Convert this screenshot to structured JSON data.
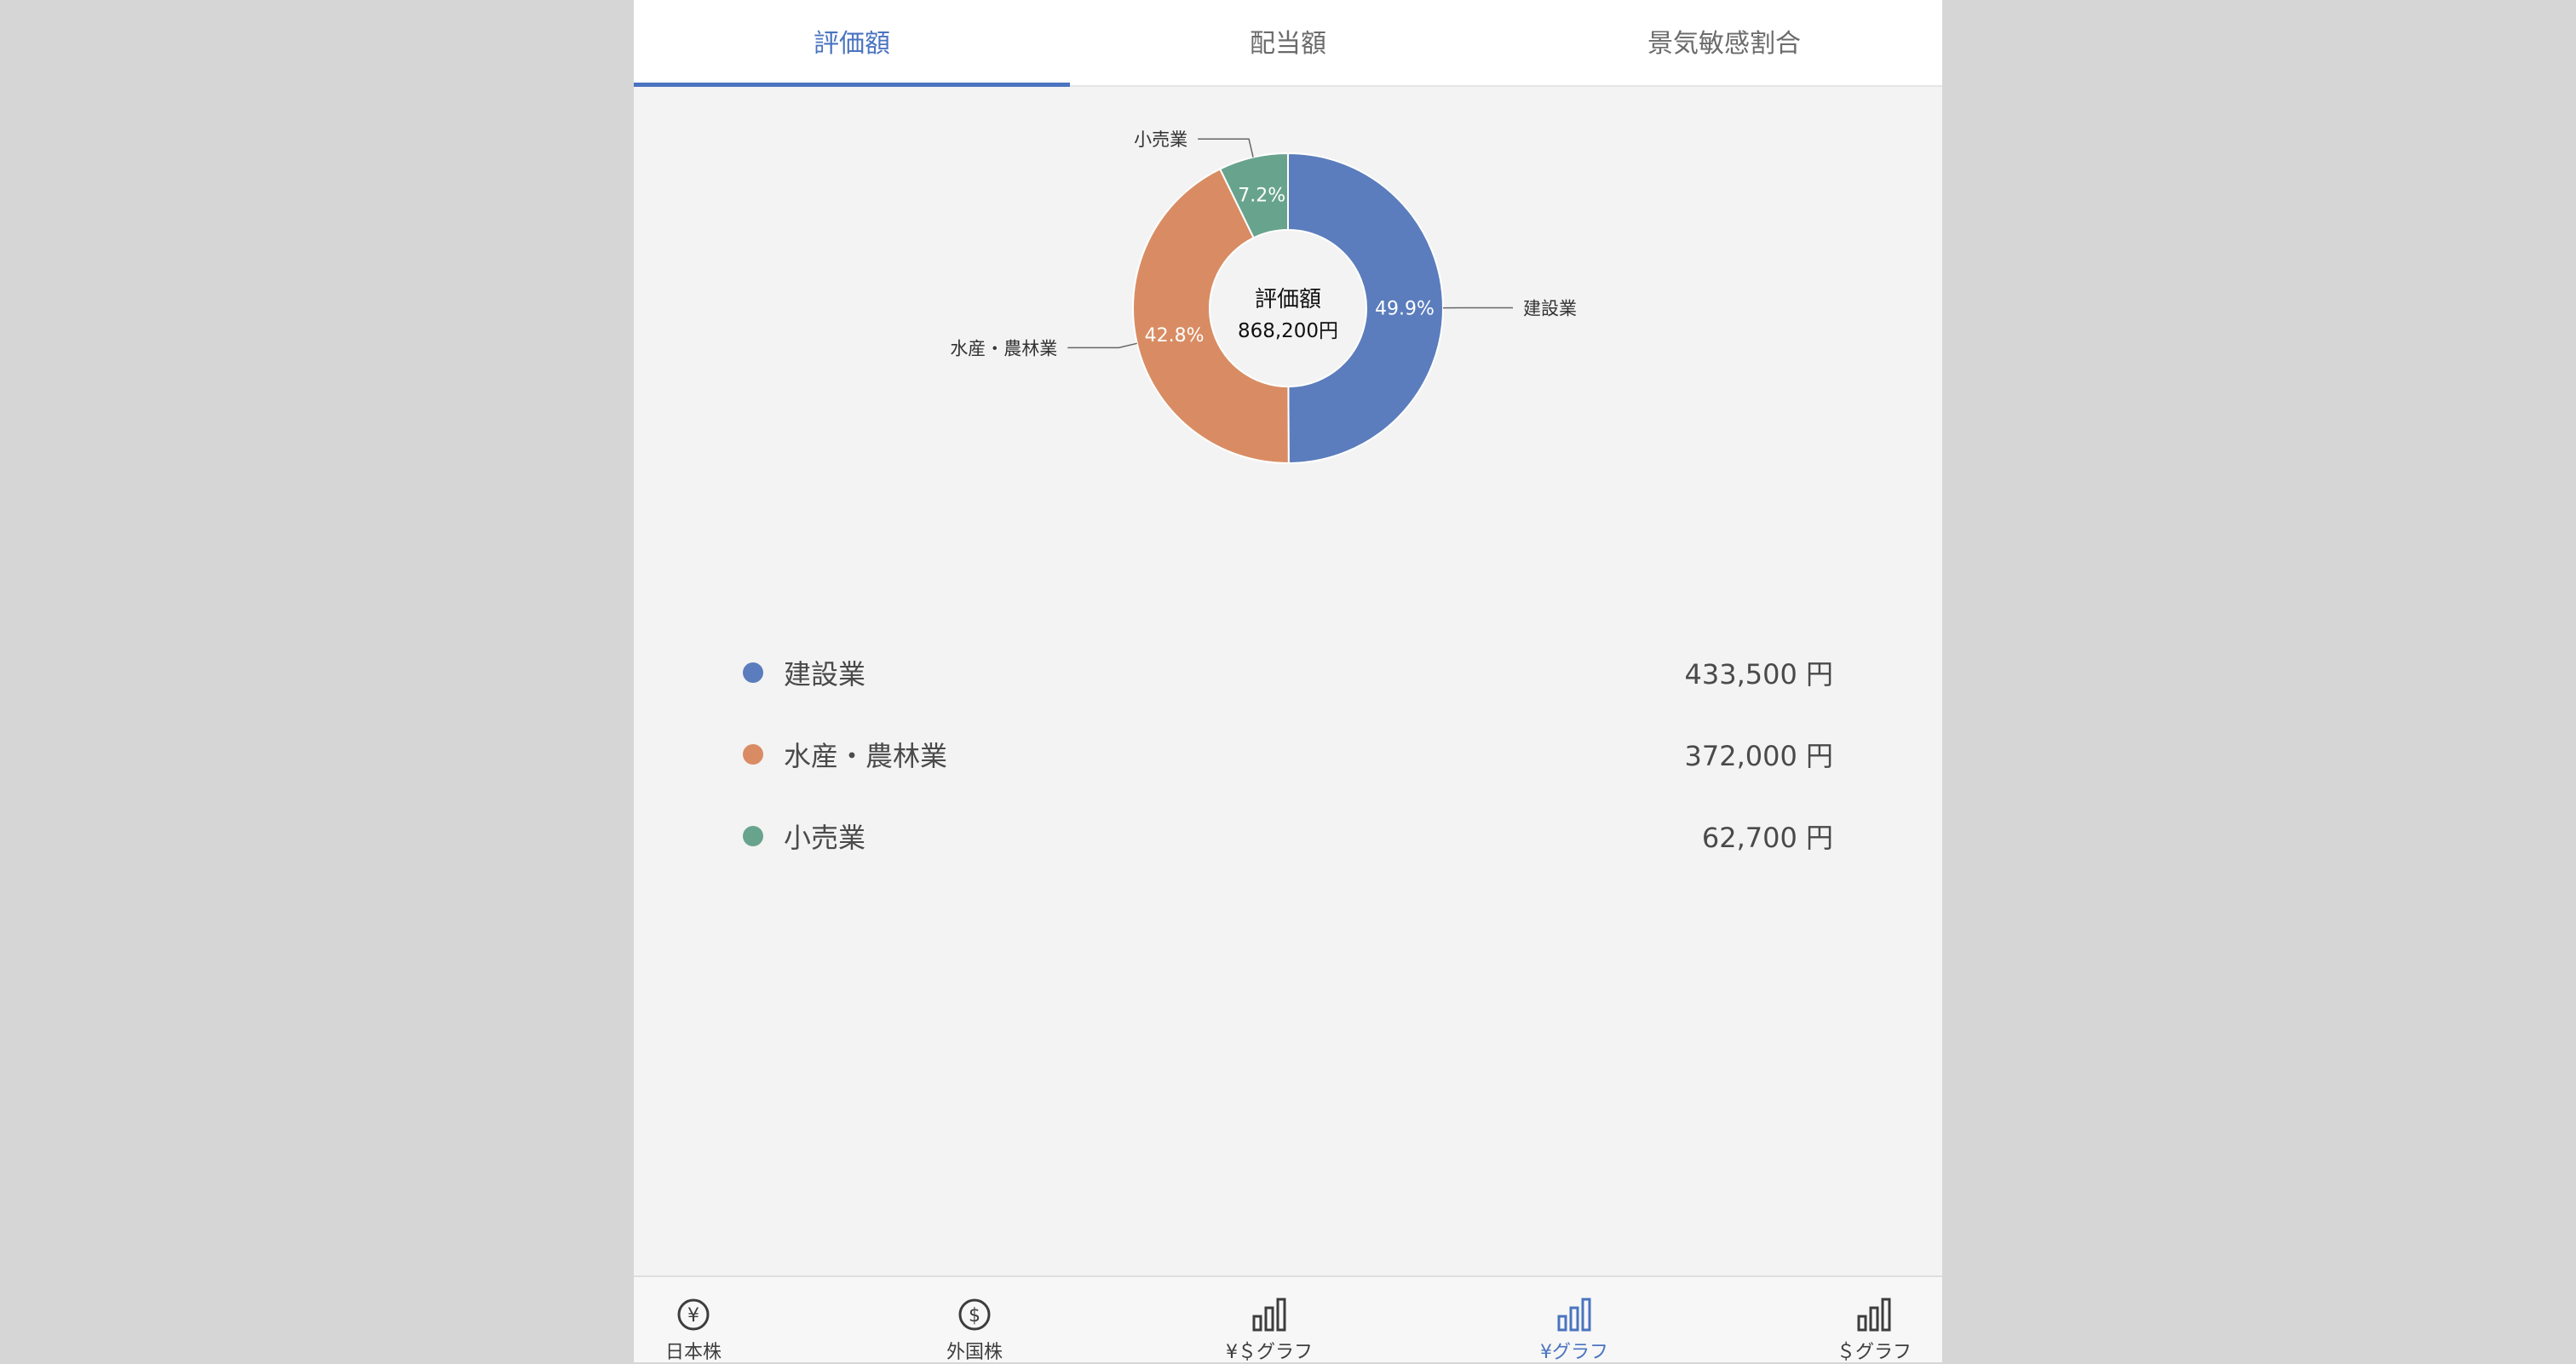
{
  "tabs": [
    {
      "label": "評価額",
      "active": true
    },
    {
      "label": "配当額",
      "active": false
    },
    {
      "label": "景気敏感割合",
      "active": false
    }
  ],
  "chart_data": {
    "type": "pie",
    "donut": true,
    "center_title": "評価額",
    "center_value": "868,200円",
    "slices": [
      {
        "label": "建設業",
        "value": 433500,
        "percent_label": "49.9%",
        "color": "#5b7dbd"
      },
      {
        "label": "水産・農林業",
        "value": 372000,
        "percent_label": "42.8%",
        "color": "#d98c63"
      },
      {
        "label": "小売業",
        "value": 62700,
        "percent_label": "7.2%",
        "color": "#68a38d"
      }
    ]
  },
  "legend": [
    {
      "name": "建設業",
      "value": "433,500 円",
      "color": "#5b7dbd"
    },
    {
      "name": "水産・農林業",
      "value": "372,000 円",
      "color": "#d98c63"
    },
    {
      "name": "小売業",
      "value": "62,700 円",
      "color": "#68a38d"
    }
  ],
  "bottom_nav": [
    {
      "label": "日本株",
      "icon": "yen-circle-icon",
      "active": false
    },
    {
      "label": "外国株",
      "icon": "dollar-circle-icon",
      "active": false
    },
    {
      "label": "¥＄グラフ",
      "icon": "bar-chart-icon",
      "active": false
    },
    {
      "label": "¥グラフ",
      "icon": "bar-chart-icon",
      "active": true
    },
    {
      "label": "＄グラフ",
      "icon": "bar-chart-icon",
      "active": false
    }
  ],
  "colors": {
    "accent": "#4a74c0",
    "background": "#f3f3f3",
    "inactive": "#3d3d3d"
  }
}
